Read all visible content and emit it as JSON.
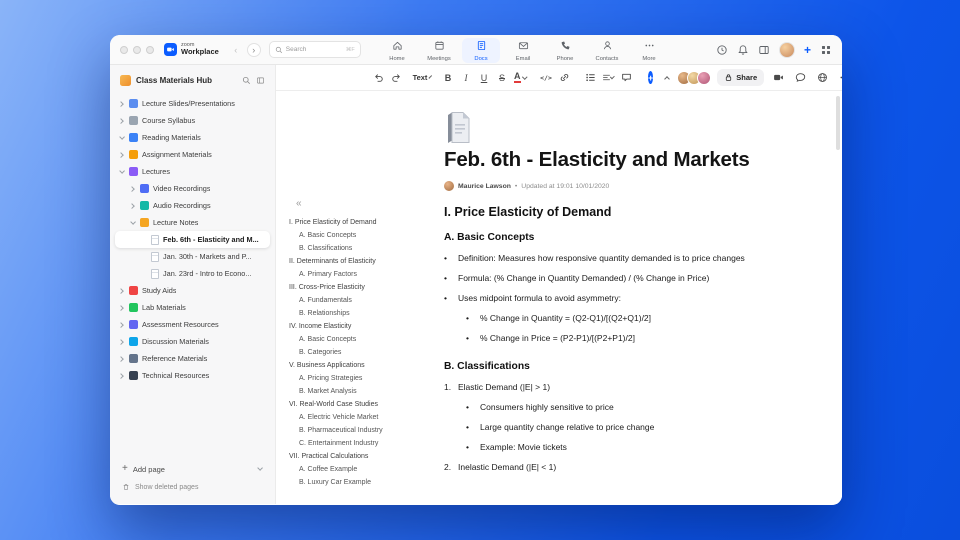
{
  "app": {
    "brand_top": "zoom",
    "brand_bottom": "Workplace",
    "search": {
      "placeholder": "Search",
      "shortcut": "⌘F"
    },
    "tabs": [
      {
        "label": "Home",
        "icon": "home"
      },
      {
        "label": "Meetings",
        "icon": "meetings"
      },
      {
        "label": "Docs",
        "icon": "docs",
        "active": true
      },
      {
        "label": "Email",
        "icon": "email"
      },
      {
        "label": "Phone",
        "icon": "phone"
      },
      {
        "label": "Contacts",
        "icon": "contacts"
      },
      {
        "label": "More",
        "icon": "more"
      }
    ]
  },
  "sidebar": {
    "title": "Class Materials Hub",
    "add_page": "Add page",
    "show_deleted": "Show deleted pages",
    "items": [
      {
        "label": "Lecture Slides/Presentations",
        "depth": 0,
        "chev": "right",
        "color": "#5b8def",
        "icon": "lecture-slides"
      },
      {
        "label": "Course Syllabus",
        "depth": 0,
        "chev": "right",
        "color": "#9aa5b1",
        "icon": "course-syllabus"
      },
      {
        "label": "Reading Materials",
        "depth": 0,
        "chev": "down",
        "color": "#3b82f6",
        "icon": "reading-materials"
      },
      {
        "label": "Assignment Materials",
        "depth": 0,
        "chev": "right",
        "color": "#f59e0b",
        "icon": "assignment-materials"
      },
      {
        "label": "Lectures",
        "depth": 0,
        "chev": "down",
        "color": "#8b5cf6",
        "icon": "lectures"
      },
      {
        "label": "Video Recordings",
        "depth": 1,
        "chev": "right",
        "color": "#4f6df5",
        "icon": "video-recordings"
      },
      {
        "label": "Audio Recordings",
        "depth": 1,
        "chev": "right",
        "color": "#14b8a6",
        "icon": "audio-recordings"
      },
      {
        "label": "Lecture Notes",
        "depth": 1,
        "chev": "down",
        "color": "#f5a623",
        "icon": "lecture-notes"
      },
      {
        "label": "Feb. 6th - Elasticity and M...",
        "depth": 2,
        "chev": "none",
        "page": true,
        "selected": true,
        "icon": "note-feb-6"
      },
      {
        "label": "Jan. 30th - Markets and P...",
        "depth": 2,
        "chev": "none",
        "page": true,
        "icon": "note-jan-30"
      },
      {
        "label": "Jan. 23rd - Intro to Econo...",
        "depth": 2,
        "chev": "none",
        "page": true,
        "icon": "note-jan-23"
      },
      {
        "label": "Study Aids",
        "depth": 0,
        "chev": "right",
        "color": "#ef4444",
        "icon": "study-aids"
      },
      {
        "label": "Lab Materials",
        "depth": 0,
        "chev": "right",
        "color": "#22c55e",
        "icon": "lab-materials"
      },
      {
        "label": "Assessment Resources",
        "depth": 0,
        "chev": "right",
        "color": "#6366f1",
        "icon": "assessment-resources"
      },
      {
        "label": "Discussion Materials",
        "depth": 0,
        "chev": "right",
        "color": "#0ea5e9",
        "icon": "discussion-materials"
      },
      {
        "label": "Reference Materials",
        "depth": 0,
        "chev": "right",
        "color": "#64748b",
        "icon": "reference-materials"
      },
      {
        "label": "Technical Resources",
        "depth": 0,
        "chev": "right",
        "color": "#374151",
        "icon": "technical-resources"
      }
    ]
  },
  "toolbar": {
    "text_style": "Text",
    "share_label": "Share",
    "collaborators": [
      {
        "c1": "#e8b98a",
        "c2": "#a06a3f"
      },
      {
        "c1": "#f3d9a6",
        "c2": "#c09355"
      },
      {
        "c1": "#e9a0b5",
        "c2": "#b05575"
      }
    ]
  },
  "document": {
    "title": "Feb. 6th - Elasticity and Markets",
    "author": "Maurice Lawson",
    "meta_sep": "•",
    "updated": "Updated at 19:01 10/01/2020",
    "outline": [
      {
        "text": "I. Price Elasticity of Demand",
        "level": 0
      },
      {
        "text": "A. Basic Concepts",
        "level": 1
      },
      {
        "text": "B. Classifications",
        "level": 1
      },
      {
        "text": "II. Determinants of Elasticity",
        "level": 0
      },
      {
        "text": "A. Primary Factors",
        "level": 1
      },
      {
        "text": "III. Cross-Price Elasticity",
        "level": 0
      },
      {
        "text": "A. Fundamentals",
        "level": 1
      },
      {
        "text": "B. Relationships",
        "level": 1
      },
      {
        "text": "IV. Income Elasticity",
        "level": 0
      },
      {
        "text": "A. Basic Concepts",
        "level": 1
      },
      {
        "text": "B. Categories",
        "level": 1
      },
      {
        "text": "V. Business Applications",
        "level": 0
      },
      {
        "text": "A. Pricing Strategies",
        "level": 1
      },
      {
        "text": "B. Market Analysis",
        "level": 1
      },
      {
        "text": "VI. Real-World Case Studies",
        "level": 0
      },
      {
        "text": "A. Electric Vehicle Market",
        "level": 1
      },
      {
        "text": "B. Pharmaceutical Industry",
        "level": 1
      },
      {
        "text": "C. Entertainment Industry",
        "level": 1
      },
      {
        "text": "VII. Practical Calculations",
        "level": 0
      },
      {
        "text": "A. Coffee Example",
        "level": 1
      },
      {
        "text": "B. Luxury Car Example",
        "level": 1
      }
    ],
    "content": {
      "heading": "I. Price Elasticity of Demand",
      "blocks": [
        {
          "type": "h3",
          "text": "A. Basic Concepts"
        },
        {
          "type": "bullet",
          "level": 0,
          "text": "Definition: Measures how responsive quantity demanded is to price changes"
        },
        {
          "type": "bullet",
          "level": 0,
          "text": "Formula: (% Change in Quantity Demanded) / (% Change in Price)"
        },
        {
          "type": "bullet",
          "level": 0,
          "text": "Uses midpoint formula to avoid asymmetry:"
        },
        {
          "type": "bullet",
          "level": 1,
          "text": "% Change in Quantity = (Q2-Q1)/[(Q2+Q1)/2]"
        },
        {
          "type": "bullet",
          "level": 1,
          "text": "% Change in Price = (P2-P1)/[(P2+P1)/2]"
        },
        {
          "type": "h3",
          "text": "B. Classifications"
        },
        {
          "type": "number",
          "marker": "1.",
          "text": "Elastic Demand (|E| > 1)"
        },
        {
          "type": "bullet",
          "level": 1,
          "text": "Consumers highly sensitive to price"
        },
        {
          "type": "bullet",
          "level": 1,
          "text": "Large quantity change relative to price change"
        },
        {
          "type": "bullet",
          "level": 1,
          "text": "Example: Movie tickets"
        },
        {
          "type": "number",
          "marker": "2.",
          "text": "Inelastic Demand (|E| < 1)"
        }
      ]
    }
  }
}
